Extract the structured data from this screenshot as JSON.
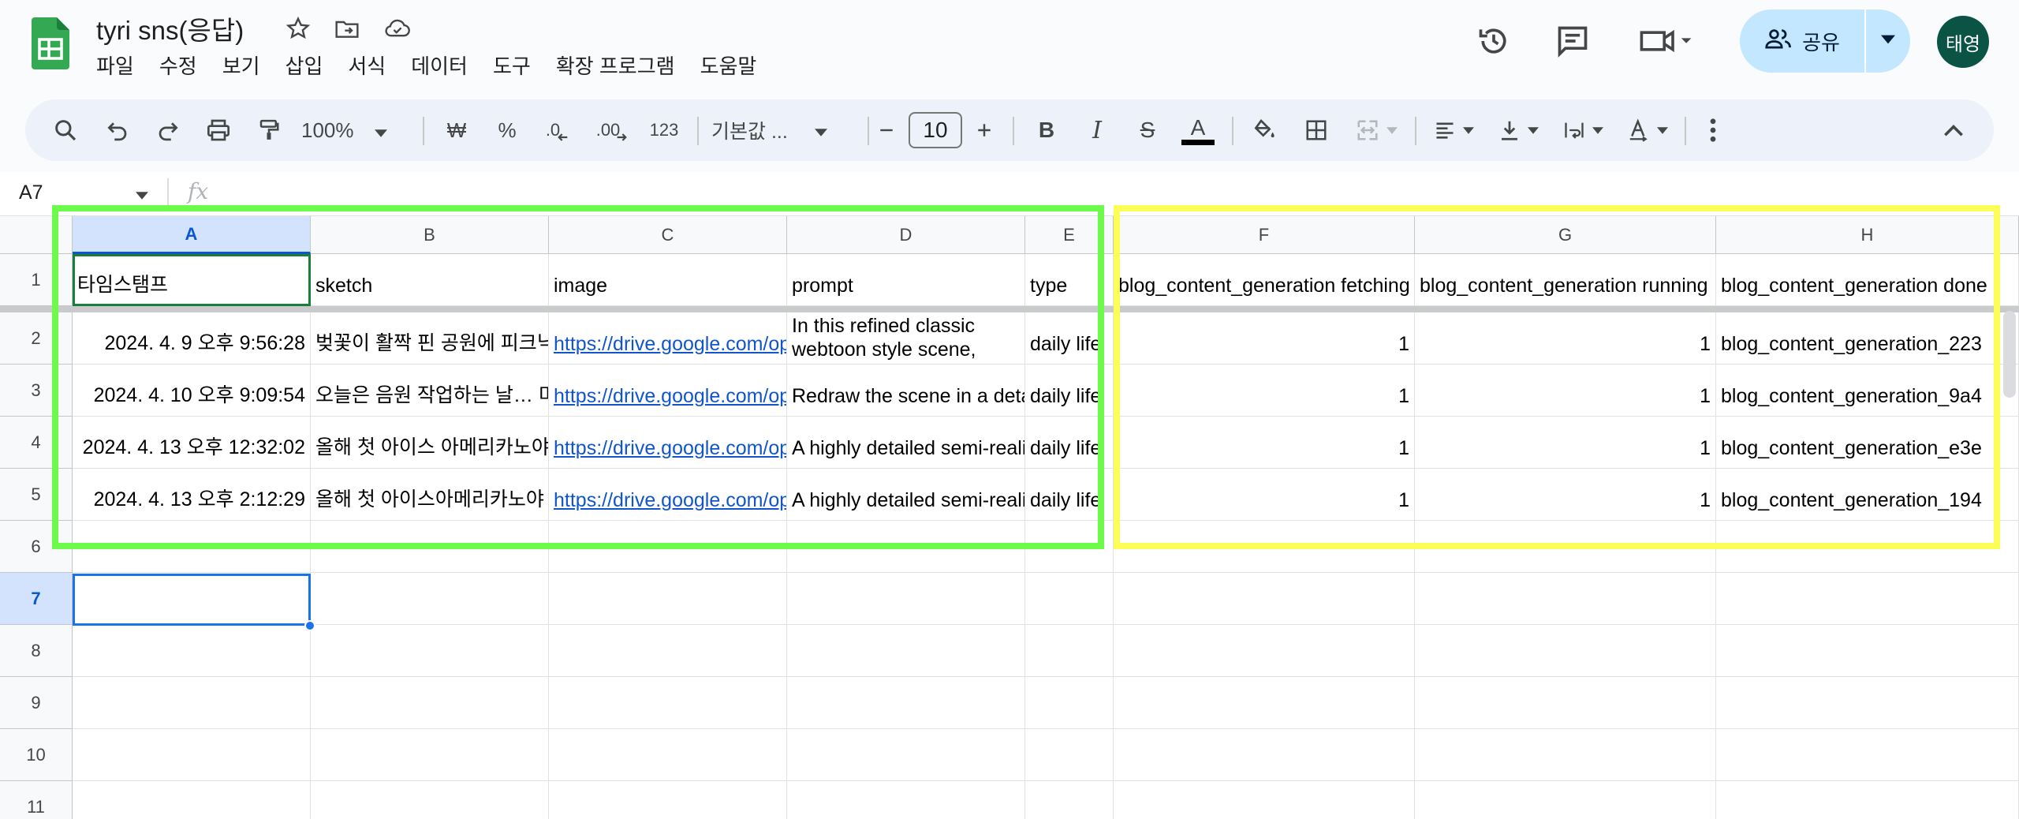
{
  "app": {
    "title": "tyri sns(응답)",
    "menu": [
      "파일",
      "수정",
      "보기",
      "삽입",
      "서식",
      "데이터",
      "도구",
      "확장 프로그램",
      "도움말"
    ],
    "share_label": "공유",
    "avatar_text": "태영"
  },
  "toolbar": {
    "zoom": "100%",
    "currency": "₩",
    "percent": "%",
    "dec_decrease": ".0",
    "dec_increase": ".00",
    "number_format": "123",
    "font": "기본값 ...",
    "font_size": "10",
    "bold": "B",
    "italic": "I",
    "strike": "S",
    "text_color": "A"
  },
  "formula_bar": {
    "name_box": "A7",
    "fx": "fx"
  },
  "grid": {
    "columns": [
      "A",
      "B",
      "C",
      "D",
      "E",
      "F",
      "G",
      "H"
    ],
    "selected_column": "A",
    "rows": [
      "1",
      "2",
      "3",
      "4",
      "5",
      "6",
      "7",
      "8",
      "9",
      "10",
      "11"
    ],
    "selected_row": "7",
    "header_row": [
      "타임스탬프",
      "sketch",
      "image",
      "prompt",
      "type",
      "blog_content_generation fetching",
      "blog_content_generation running",
      "blog_content_generation done"
    ],
    "data_rows": [
      [
        "2024. 4. 9 오후 9:56:28",
        "벚꽃이 활짝 핀 공원에 피크닉",
        "https://drive.google.com/open",
        "In this refined classic webtoon style scene,",
        "daily life",
        "1",
        "1",
        "blog_content_generation_223"
      ],
      [
        "2024. 4. 10 오후 9:09:54",
        "오늘은 음원 작업하는 날… 미",
        "https://drive.google.com/open",
        "Redraw the scene in a detailed",
        "daily life",
        "1",
        "1",
        "blog_content_generation_9a4"
      ],
      [
        "2024. 4. 13 오후 12:32:02",
        "올해 첫 아이스 아메리카노야",
        "https://drive.google.com/open",
        "A highly detailed semi-realistic",
        "daily life",
        "1",
        "1",
        "blog_content_generation_e3e"
      ],
      [
        "2024. 4. 13 오후 2:12:29",
        "올해 첫 아이스아메리카노야",
        "https://drive.google.com/open",
        "A highly detailed semi-realistic",
        "daily life",
        "1",
        "1",
        "blog_content_generation_194"
      ]
    ]
  },
  "colors": {
    "green_highlight": "#6dfb4b",
    "yellow_highlight": "#fdfd57",
    "link": "#1155cc",
    "selection": "#1a73e8"
  }
}
